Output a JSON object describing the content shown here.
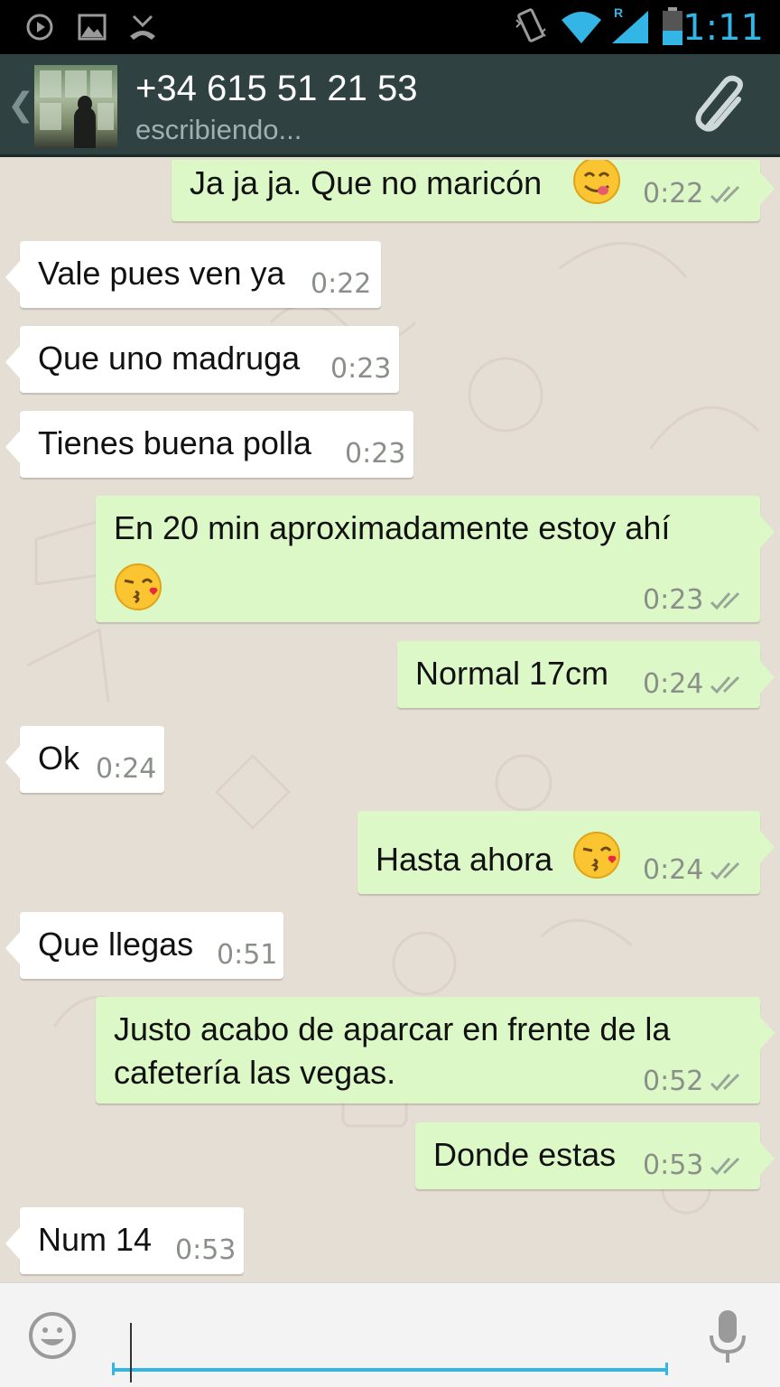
{
  "status_bar": {
    "time": "1:11",
    "roaming_label": "R",
    "icons": [
      "play-icon",
      "image-icon",
      "missed-call-icon",
      "vibrate-icon",
      "wifi-icon",
      "signal-icon",
      "battery-icon"
    ],
    "accent_color": "#33b5e5"
  },
  "header": {
    "contact": "+34 615 51 21 53",
    "status": "escribiendo...",
    "background_color": "#2f4141",
    "icons": [
      "back-chevron-icon",
      "avatar",
      "paperclip-icon"
    ]
  },
  "messages": [
    {
      "dir": "out",
      "text": "Ja ja ja. Que no maricón",
      "time": "0:22",
      "emoji": "yum"
    },
    {
      "dir": "in",
      "text": "Vale pues ven ya",
      "time": "0:22"
    },
    {
      "dir": "in",
      "text": "Que uno madruga",
      "time": "0:23"
    },
    {
      "dir": "in",
      "text": "Tienes buena polla",
      "time": "0:23"
    },
    {
      "dir": "out",
      "text": "En 20 min aproximadamente estoy ahí",
      "time": "0:23",
      "emoji": "kiss"
    },
    {
      "dir": "out",
      "text": "Normal 17cm",
      "time": "0:24"
    },
    {
      "dir": "in",
      "text": "Ok",
      "time": "0:24"
    },
    {
      "dir": "out",
      "text": "Hasta ahora",
      "time": "0:24",
      "emoji": "kiss"
    },
    {
      "dir": "in",
      "text": "Que llegas",
      "time": "0:51"
    },
    {
      "dir": "out",
      "text": "Justo acabo de aparcar en frente de la",
      "text2": "cafetería las vegas.",
      "time": "0:52"
    },
    {
      "dir": "out",
      "text": "Donde estas",
      "time": "0:53"
    },
    {
      "dir": "in",
      "text": "Num 14",
      "time": "0:53"
    }
  ],
  "input": {
    "value": "",
    "placeholder": "",
    "icons": [
      "smiley-icon",
      "microphone-icon"
    ]
  },
  "colors": {
    "incoming_bubble": "#ffffff",
    "outgoing_bubble": "#dcf8c6",
    "chat_background": "#e5ded4"
  }
}
